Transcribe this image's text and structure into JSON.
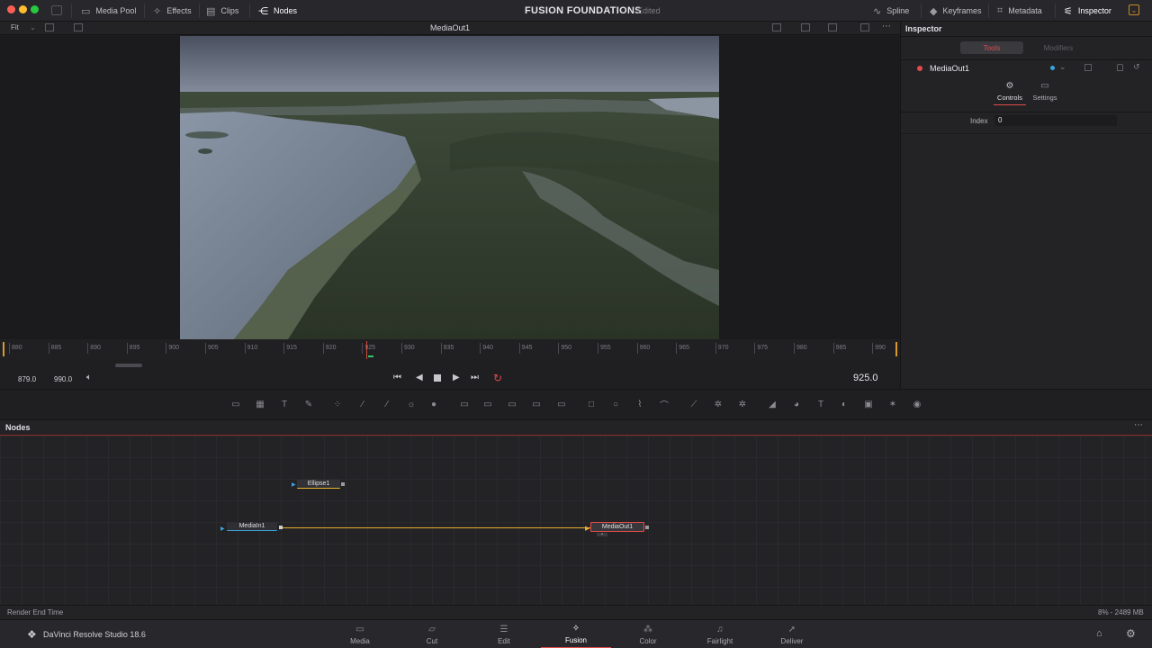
{
  "colors": {
    "accent_red": "#e04b4b",
    "playhead": "#d24a3a",
    "link_yellow": "#e6b030",
    "node_blue": "#3aa3e0"
  },
  "topbar": {
    "media_pool": "Media Pool",
    "effects": "Effects",
    "clips": "Clips",
    "nodes": "Nodes",
    "project_title": "FUSION FOUNDATIONS",
    "project_status": "Edited",
    "spline": "Spline",
    "keyframes": "Keyframes",
    "metadata": "Metadata",
    "inspector": "Inspector"
  },
  "viewer": {
    "fit_label": "Fit",
    "node_name": "MediaOut1"
  },
  "inspector": {
    "title": "Inspector",
    "tab_tools": "Tools",
    "tab_modifiers": "Modifiers",
    "node_name": "MediaOut1",
    "subtab_controls": "Controls",
    "subtab_settings": "Settings",
    "index_label": "Index",
    "index_value": "0"
  },
  "timeline": {
    "ticks": [
      "880",
      "885",
      "890",
      "895",
      "900",
      "905",
      "910",
      "915",
      "920",
      "925",
      "930",
      "935",
      "940",
      "945",
      "950",
      "955",
      "960",
      "965",
      "970",
      "975",
      "980",
      "985",
      "990"
    ],
    "start_frame": "879.0",
    "end_frame": "990.0",
    "current_frame": "925.0"
  },
  "nodes_panel": {
    "title": "Nodes",
    "ellipse": "Ellipse1",
    "media_in": "MediaIn1",
    "media_out": "MediaOut1"
  },
  "status": {
    "left": "Render End Time",
    "right": "8% - 2489 MB"
  },
  "app": {
    "name": "DaVinci Resolve Studio 18.6"
  },
  "pages": {
    "media": "Media",
    "cut": "Cut",
    "edit": "Edit",
    "fusion": "Fusion",
    "color": "Color",
    "fairlight": "Fairlight",
    "deliver": "Deliver"
  }
}
